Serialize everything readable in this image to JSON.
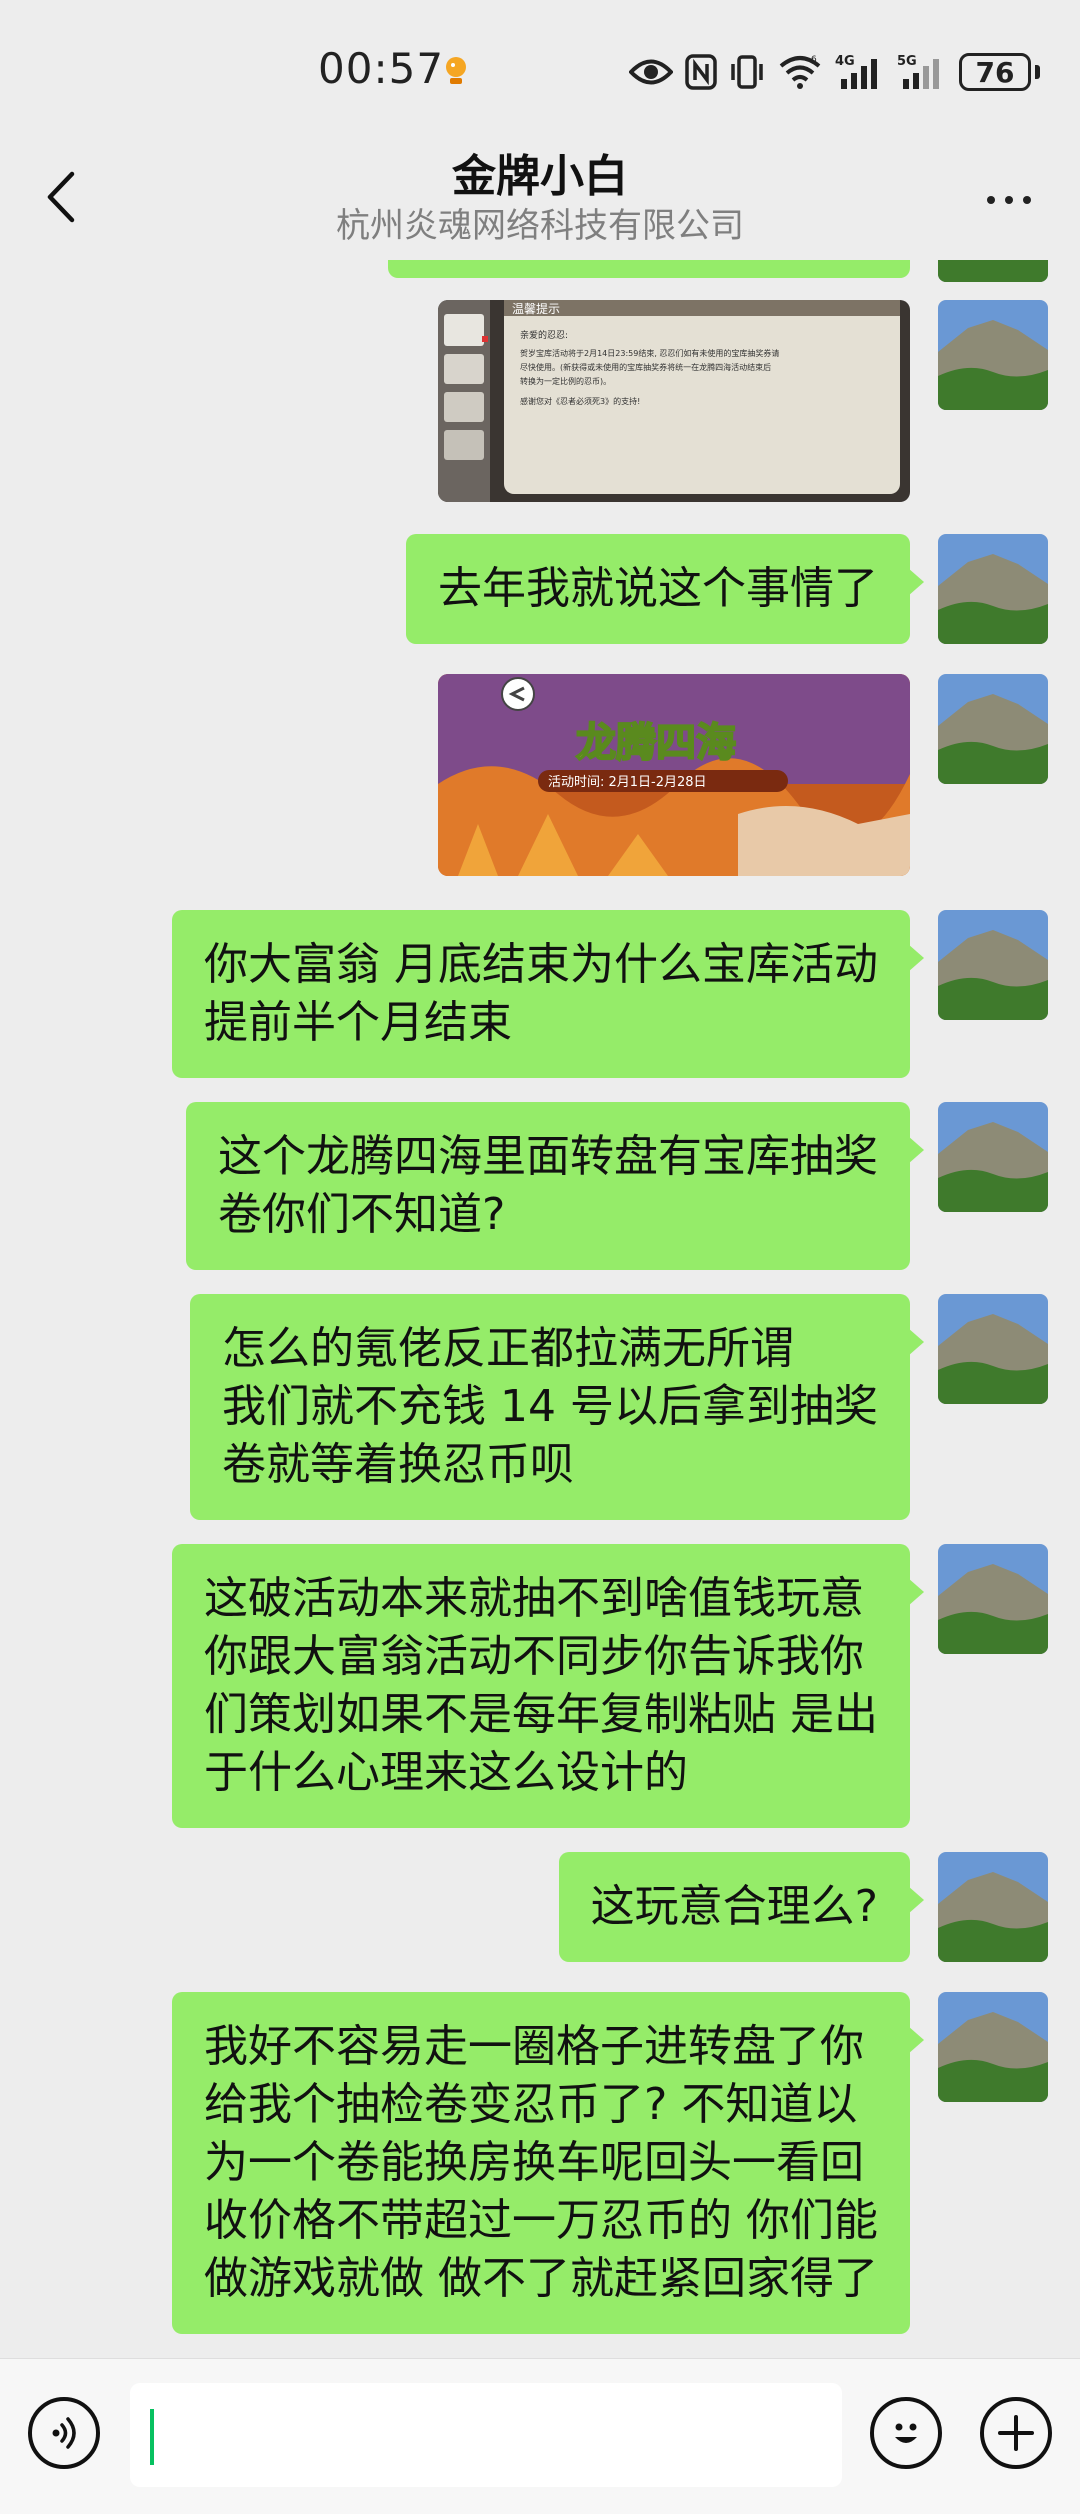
{
  "status_bar": {
    "time": "00:57",
    "battery": "76",
    "icons": [
      "app-notification-icon",
      "eye-icon",
      "nfc-icon",
      "vibrate-icon",
      "wifi-icon",
      "4g-signal-icon",
      "5g-signal-icon",
      "battery-icon"
    ]
  },
  "header": {
    "title": "金牌小白",
    "subtitle": "杭州炎魂网络科技有限公司"
  },
  "messages": [
    {
      "type": "image",
      "sender": "me",
      "image_text": [
        "温馨提示",
        "亲爱的忍忍:",
        "贺岁宝库活动将于2月14日23:59结束, 忍忍们如有未使用的宝库抽奖券请",
        "尽快使用。(新获得或未使用的宝库抽奖券将统一在龙腾四海活动结束后",
        "转换为一定比例的忍币)。",
        "感谢您对《忍者必须死3》的支持!"
      ]
    },
    {
      "type": "text",
      "sender": "me",
      "text": "去年我就说这个事情了"
    },
    {
      "type": "image",
      "sender": "me",
      "image_text": [
        "龙腾四海",
        "活动时间: 2月1日-2月28日"
      ]
    },
    {
      "type": "text",
      "sender": "me",
      "text": "你大富翁 月底结束为什么宝库活动\n提前半个月结束"
    },
    {
      "type": "text",
      "sender": "me",
      "text": "这个龙腾四海里面转盘有宝库抽奖\n卷你们不知道?"
    },
    {
      "type": "text",
      "sender": "me",
      "text": "怎么的氪佬反正都拉满无所谓\n我们就不充钱 14 号以后拿到抽奖\n卷就等着换忍币呗"
    },
    {
      "type": "text",
      "sender": "me",
      "text": "这破活动本来就抽不到啥值钱玩意\n你跟大富翁活动不同步你告诉我你\n们策划如果不是每年复制粘贴 是出\n于什么心理来这么设计的"
    },
    {
      "type": "text",
      "sender": "me",
      "text": "这玩意合理么?"
    },
    {
      "type": "text",
      "sender": "me",
      "text": "我好不容易走一圈格子进转盘了你\n给我个抽检卷变忍币了? 不知道以\n为一个卷能换房换车呢回头一看回\n收价格不带超过一万忍币的 你们能\n做游戏就做 做不了就赶紧回家得了"
    }
  ],
  "input_bar": {
    "placeholder": "",
    "value": "",
    "left_button": "voice-icon",
    "right_buttons": [
      "emoji-icon",
      "plus-icon"
    ]
  },
  "colors": {
    "background": "#ededed",
    "bubble_me": "#95ec69",
    "caret": "#07c160",
    "subtitle": "#7f7f7f"
  }
}
